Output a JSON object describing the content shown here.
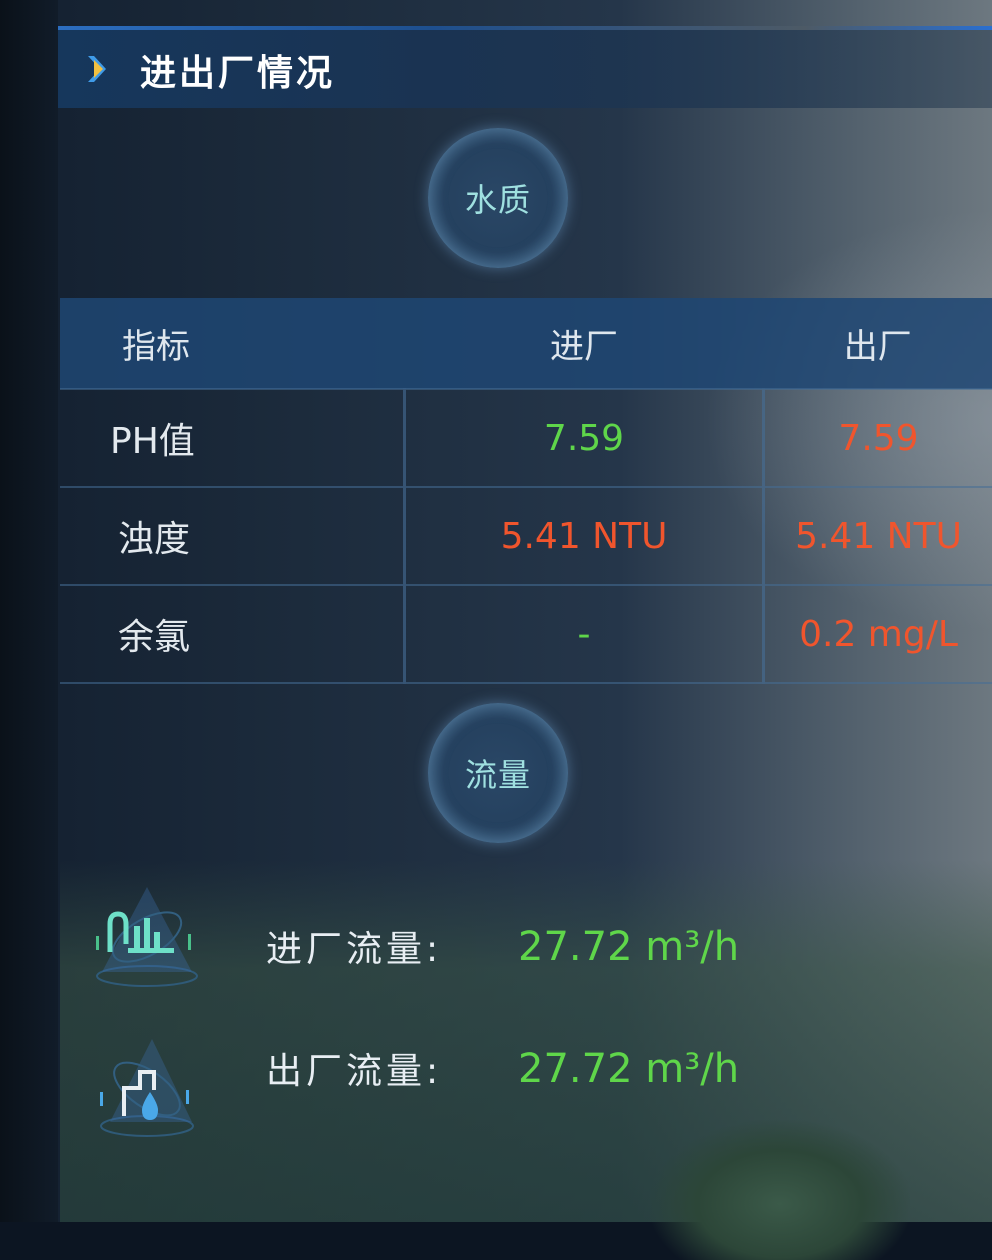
{
  "header": {
    "title": "进出厂情况",
    "icon": "chevron-right-icon"
  },
  "water_quality": {
    "badge": "水质",
    "columns": [
      "指标",
      "进厂",
      "出厂"
    ],
    "rows": [
      {
        "name": "PH值",
        "inlet": "7.59",
        "outlet": "7.59"
      },
      {
        "name": "浊度",
        "inlet": "5.41 NTU",
        "outlet": "5.41 NTU"
      },
      {
        "name": "余氯",
        "inlet": "-",
        "outlet": "0.2 mg/L"
      }
    ]
  },
  "flow": {
    "badge": "流量",
    "items": [
      {
        "label": "进厂流量:",
        "value": "27.72 m³/h",
        "icon": "inflow-chart-icon"
      },
      {
        "label": "出厂流量:",
        "value": "27.72 m³/h",
        "icon": "outflow-drop-icon"
      }
    ]
  },
  "colors": {
    "good": "#5fd64a",
    "alert": "#f0552d",
    "accent": "#9fe0e0"
  }
}
